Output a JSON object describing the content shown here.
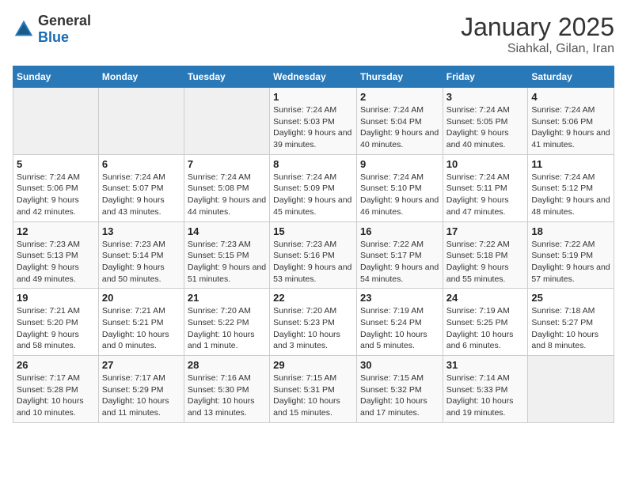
{
  "logo": {
    "general": "General",
    "blue": "Blue"
  },
  "title": "January 2025",
  "subtitle": "Siahkal, Gilan, Iran",
  "days_of_week": [
    "Sunday",
    "Monday",
    "Tuesday",
    "Wednesday",
    "Thursday",
    "Friday",
    "Saturday"
  ],
  "weeks": [
    [
      {
        "day": "",
        "sunrise": "",
        "sunset": "",
        "daylight": "",
        "empty": true
      },
      {
        "day": "",
        "sunrise": "",
        "sunset": "",
        "daylight": "",
        "empty": true
      },
      {
        "day": "",
        "sunrise": "",
        "sunset": "",
        "daylight": "",
        "empty": true
      },
      {
        "day": "1",
        "sunrise": "Sunrise: 7:24 AM",
        "sunset": "Sunset: 5:03 PM",
        "daylight": "Daylight: 9 hours and 39 minutes."
      },
      {
        "day": "2",
        "sunrise": "Sunrise: 7:24 AM",
        "sunset": "Sunset: 5:04 PM",
        "daylight": "Daylight: 9 hours and 40 minutes."
      },
      {
        "day": "3",
        "sunrise": "Sunrise: 7:24 AM",
        "sunset": "Sunset: 5:05 PM",
        "daylight": "Daylight: 9 hours and 40 minutes."
      },
      {
        "day": "4",
        "sunrise": "Sunrise: 7:24 AM",
        "sunset": "Sunset: 5:06 PM",
        "daylight": "Daylight: 9 hours and 41 minutes."
      }
    ],
    [
      {
        "day": "5",
        "sunrise": "Sunrise: 7:24 AM",
        "sunset": "Sunset: 5:06 PM",
        "daylight": "Daylight: 9 hours and 42 minutes."
      },
      {
        "day": "6",
        "sunrise": "Sunrise: 7:24 AM",
        "sunset": "Sunset: 5:07 PM",
        "daylight": "Daylight: 9 hours and 43 minutes."
      },
      {
        "day": "7",
        "sunrise": "Sunrise: 7:24 AM",
        "sunset": "Sunset: 5:08 PM",
        "daylight": "Daylight: 9 hours and 44 minutes."
      },
      {
        "day": "8",
        "sunrise": "Sunrise: 7:24 AM",
        "sunset": "Sunset: 5:09 PM",
        "daylight": "Daylight: 9 hours and 45 minutes."
      },
      {
        "day": "9",
        "sunrise": "Sunrise: 7:24 AM",
        "sunset": "Sunset: 5:10 PM",
        "daylight": "Daylight: 9 hours and 46 minutes."
      },
      {
        "day": "10",
        "sunrise": "Sunrise: 7:24 AM",
        "sunset": "Sunset: 5:11 PM",
        "daylight": "Daylight: 9 hours and 47 minutes."
      },
      {
        "day": "11",
        "sunrise": "Sunrise: 7:24 AM",
        "sunset": "Sunset: 5:12 PM",
        "daylight": "Daylight: 9 hours and 48 minutes."
      }
    ],
    [
      {
        "day": "12",
        "sunrise": "Sunrise: 7:23 AM",
        "sunset": "Sunset: 5:13 PM",
        "daylight": "Daylight: 9 hours and 49 minutes."
      },
      {
        "day": "13",
        "sunrise": "Sunrise: 7:23 AM",
        "sunset": "Sunset: 5:14 PM",
        "daylight": "Daylight: 9 hours and 50 minutes."
      },
      {
        "day": "14",
        "sunrise": "Sunrise: 7:23 AM",
        "sunset": "Sunset: 5:15 PM",
        "daylight": "Daylight: 9 hours and 51 minutes."
      },
      {
        "day": "15",
        "sunrise": "Sunrise: 7:23 AM",
        "sunset": "Sunset: 5:16 PM",
        "daylight": "Daylight: 9 hours and 53 minutes."
      },
      {
        "day": "16",
        "sunrise": "Sunrise: 7:22 AM",
        "sunset": "Sunset: 5:17 PM",
        "daylight": "Daylight: 9 hours and 54 minutes."
      },
      {
        "day": "17",
        "sunrise": "Sunrise: 7:22 AM",
        "sunset": "Sunset: 5:18 PM",
        "daylight": "Daylight: 9 hours and 55 minutes."
      },
      {
        "day": "18",
        "sunrise": "Sunrise: 7:22 AM",
        "sunset": "Sunset: 5:19 PM",
        "daylight": "Daylight: 9 hours and 57 minutes."
      }
    ],
    [
      {
        "day": "19",
        "sunrise": "Sunrise: 7:21 AM",
        "sunset": "Sunset: 5:20 PM",
        "daylight": "Daylight: 9 hours and 58 minutes."
      },
      {
        "day": "20",
        "sunrise": "Sunrise: 7:21 AM",
        "sunset": "Sunset: 5:21 PM",
        "daylight": "Daylight: 10 hours and 0 minutes."
      },
      {
        "day": "21",
        "sunrise": "Sunrise: 7:20 AM",
        "sunset": "Sunset: 5:22 PM",
        "daylight": "Daylight: 10 hours and 1 minute."
      },
      {
        "day": "22",
        "sunrise": "Sunrise: 7:20 AM",
        "sunset": "Sunset: 5:23 PM",
        "daylight": "Daylight: 10 hours and 3 minutes."
      },
      {
        "day": "23",
        "sunrise": "Sunrise: 7:19 AM",
        "sunset": "Sunset: 5:24 PM",
        "daylight": "Daylight: 10 hours and 5 minutes."
      },
      {
        "day": "24",
        "sunrise": "Sunrise: 7:19 AM",
        "sunset": "Sunset: 5:25 PM",
        "daylight": "Daylight: 10 hours and 6 minutes."
      },
      {
        "day": "25",
        "sunrise": "Sunrise: 7:18 AM",
        "sunset": "Sunset: 5:27 PM",
        "daylight": "Daylight: 10 hours and 8 minutes."
      }
    ],
    [
      {
        "day": "26",
        "sunrise": "Sunrise: 7:17 AM",
        "sunset": "Sunset: 5:28 PM",
        "daylight": "Daylight: 10 hours and 10 minutes."
      },
      {
        "day": "27",
        "sunrise": "Sunrise: 7:17 AM",
        "sunset": "Sunset: 5:29 PM",
        "daylight": "Daylight: 10 hours and 11 minutes."
      },
      {
        "day": "28",
        "sunrise": "Sunrise: 7:16 AM",
        "sunset": "Sunset: 5:30 PM",
        "daylight": "Daylight: 10 hours and 13 minutes."
      },
      {
        "day": "29",
        "sunrise": "Sunrise: 7:15 AM",
        "sunset": "Sunset: 5:31 PM",
        "daylight": "Daylight: 10 hours and 15 minutes."
      },
      {
        "day": "30",
        "sunrise": "Sunrise: 7:15 AM",
        "sunset": "Sunset: 5:32 PM",
        "daylight": "Daylight: 10 hours and 17 minutes."
      },
      {
        "day": "31",
        "sunrise": "Sunrise: 7:14 AM",
        "sunset": "Sunset: 5:33 PM",
        "daylight": "Daylight: 10 hours and 19 minutes."
      },
      {
        "day": "",
        "sunrise": "",
        "sunset": "",
        "daylight": "",
        "empty": true
      }
    ]
  ]
}
